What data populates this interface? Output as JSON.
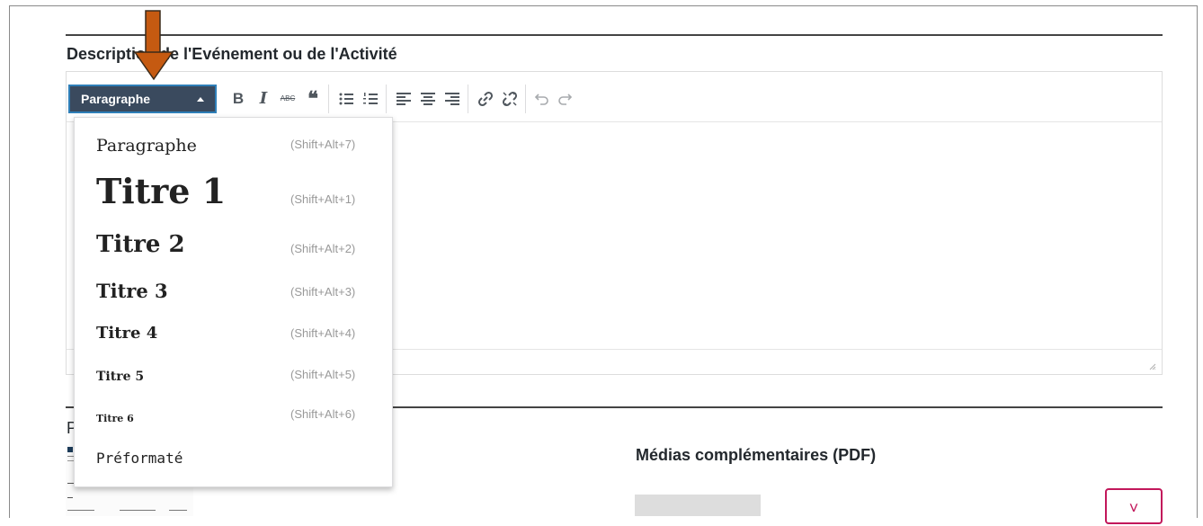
{
  "section": {
    "title": "Description de l'Evénement ou de l'Activité"
  },
  "toolbar": {
    "format_label": "Paragraphe",
    "buttons": [
      {
        "icon": "bold-icon",
        "glyph": "B"
      },
      {
        "icon": "italic-icon",
        "glyph": "I"
      },
      {
        "icon": "strikethrough-icon",
        "glyph": "ABC"
      },
      {
        "icon": "blockquote-icon",
        "glyph": "❝"
      },
      {
        "icon": "bullet-list-icon",
        "glyph": "☰"
      },
      {
        "icon": "numbered-list-icon",
        "glyph": "☷"
      },
      {
        "icon": "align-left-icon",
        "glyph": "≡"
      },
      {
        "icon": "align-center-icon",
        "glyph": "≡"
      },
      {
        "icon": "align-right-icon",
        "glyph": "≡"
      },
      {
        "icon": "link-icon",
        "glyph": "🔗"
      },
      {
        "icon": "unlink-icon",
        "glyph": "⛓"
      },
      {
        "icon": "undo-icon",
        "glyph": "↶"
      },
      {
        "icon": "redo-icon",
        "glyph": "↷"
      }
    ]
  },
  "dropdown": {
    "items": [
      {
        "label": "Paragraphe",
        "shortcut": "(Shift+Alt+7)"
      },
      {
        "label": "Titre 1",
        "shortcut": "(Shift+Alt+1)"
      },
      {
        "label": "Titre 2",
        "shortcut": "(Shift+Alt+2)"
      },
      {
        "label": "Titre 3",
        "shortcut": "(Shift+Alt+3)"
      },
      {
        "label": "Titre 4",
        "shortcut": "(Shift+Alt+4)"
      },
      {
        "label": "Titre 5",
        "shortcut": "(Shift+Alt+5)"
      },
      {
        "label": "Titre 6",
        "shortcut": "(Shift+Alt+6)"
      },
      {
        "label": "Préformaté",
        "shortcut": ""
      }
    ]
  },
  "lower": {
    "left_fragment": "P",
    "media_title": "Médias complémentaires (PDF)",
    "remove_label": "˅"
  },
  "colors": {
    "arrow": "#c55a11",
    "select_bg": "#3a4a5e",
    "select_border": "#2f7fb8",
    "remove": "#c2185b"
  }
}
